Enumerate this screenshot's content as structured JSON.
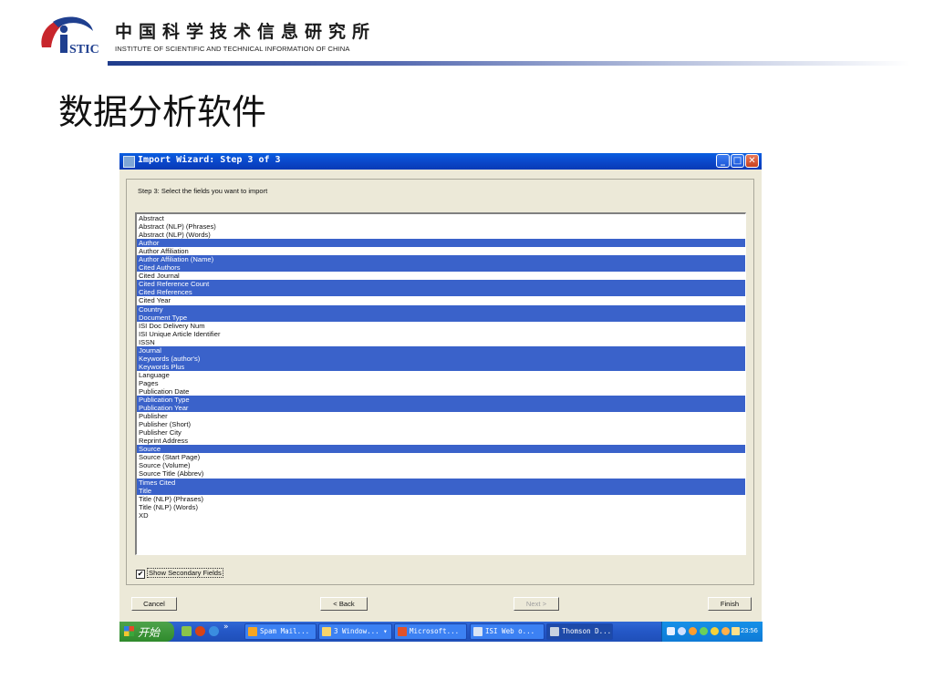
{
  "header": {
    "org_name_cn": "中国科学技术信息研究所",
    "org_name_en": "INSTITUTE OF SCIENTIFIC AND TECHNICAL INFORMATION OF CHINA",
    "logo_text": "STIC"
  },
  "slide": {
    "title": "数据分析软件"
  },
  "window": {
    "title": "Import Wizard: Step 3 of 3",
    "step_label": "Step 3: Select the fields you want to import",
    "fields": [
      {
        "label": "Abstract",
        "selected": false
      },
      {
        "label": "Abstract (NLP) (Phrases)",
        "selected": false
      },
      {
        "label": "Abstract (NLP) (Words)",
        "selected": false
      },
      {
        "label": "Author",
        "selected": true
      },
      {
        "label": "Author Affiliation",
        "selected": false
      },
      {
        "label": "Author Affiliation (Name)",
        "selected": true
      },
      {
        "label": "Cited Authors",
        "selected": true
      },
      {
        "label": "Cited Journal",
        "selected": false
      },
      {
        "label": "Cited Reference Count",
        "selected": true
      },
      {
        "label": "Cited References",
        "selected": true
      },
      {
        "label": "Cited Year",
        "selected": false
      },
      {
        "label": "Country",
        "selected": true
      },
      {
        "label": "Document Type",
        "selected": true
      },
      {
        "label": "ISI Doc Delivery Num",
        "selected": false
      },
      {
        "label": "ISI Unique Article Identifier",
        "selected": false
      },
      {
        "label": "ISSN",
        "selected": false
      },
      {
        "label": "Journal",
        "selected": true
      },
      {
        "label": "Keywords (author's)",
        "selected": true
      },
      {
        "label": "Keywords Plus",
        "selected": true
      },
      {
        "label": "Language",
        "selected": false
      },
      {
        "label": "Pages",
        "selected": false
      },
      {
        "label": "Publication Date",
        "selected": false
      },
      {
        "label": "Publication Type",
        "selected": true
      },
      {
        "label": "Publication Year",
        "selected": true
      },
      {
        "label": "Publisher",
        "selected": false
      },
      {
        "label": "Publisher (Short)",
        "selected": false
      },
      {
        "label": "Publisher City",
        "selected": false
      },
      {
        "label": "Reprint Address",
        "selected": false
      },
      {
        "label": "Source",
        "selected": true
      },
      {
        "label": "Source (Start Page)",
        "selected": false
      },
      {
        "label": "Source (Volume)",
        "selected": false
      },
      {
        "label": "Source Title (Abbrev)",
        "selected": false
      },
      {
        "label": "Times Cited",
        "selected": true
      },
      {
        "label": "Title",
        "selected": true
      },
      {
        "label": "Title (NLP) (Phrases)",
        "selected": false
      },
      {
        "label": "Title (NLP) (Words)",
        "selected": false
      },
      {
        "label": "XD",
        "selected": false
      }
    ],
    "show_secondary": {
      "label": "Show Secondary Fields",
      "checked": true
    },
    "buttons": {
      "cancel": "Cancel",
      "back": "< Back",
      "next": "Next >",
      "next_enabled": false,
      "finish": "Finish"
    },
    "colors": {
      "selection": "#3a62ca",
      "titlebar": "#0b4cd0"
    }
  },
  "taskbar": {
    "start_label": "开始",
    "more_label": "»",
    "tasks": [
      {
        "label": "Spam Mail...",
        "icon": "mail-icon"
      },
      {
        "label": "3 Window... ▾",
        "icon": "folder-icon"
      },
      {
        "label": "Microsoft...",
        "icon": "powerpoint-icon"
      },
      {
        "label": "ISI Web o...",
        "icon": "browser-icon"
      },
      {
        "label": "Thomson D...",
        "icon": "app-icon",
        "active": true
      }
    ],
    "clock": "23:56"
  }
}
